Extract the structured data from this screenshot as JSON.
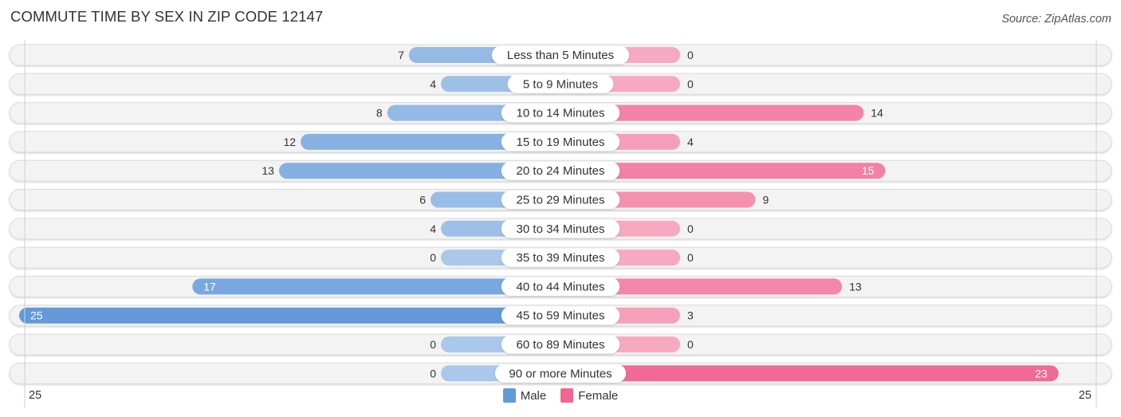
{
  "header": {
    "title": "COMMUTE TIME BY SEX IN ZIP CODE 12147",
    "source": "Source: ZipAtlas.com"
  },
  "colors": {
    "male_strong": "#6399d8",
    "male_light": "#a9c8ea",
    "female_strong": "#f06592",
    "female_light": "#f7a9c2",
    "row_bg": "#f3f3f3",
    "row_border": "#dcdcdc"
  },
  "legend": [
    {
      "label": "Male",
      "color": "#6399d8"
    },
    {
      "label": "Female",
      "color": "#f06592"
    }
  ],
  "axis": {
    "left_label": "25",
    "right_label": "25"
  },
  "chart_data": {
    "type": "bar",
    "orientation": "horizontal-diverging",
    "title": "COMMUTE TIME BY SEX IN ZIP CODE 12147",
    "source": "Source: ZipAtlas.com",
    "xlim": [
      -25,
      25
    ],
    "x_tick_labels": [
      "25",
      "25"
    ],
    "legend_position": "bottom-center",
    "categories": [
      "Less than 5 Minutes",
      "5 to 9 Minutes",
      "10 to 14 Minutes",
      "15 to 19 Minutes",
      "20 to 24 Minutes",
      "25 to 29 Minutes",
      "30 to 34 Minutes",
      "35 to 39 Minutes",
      "40 to 44 Minutes",
      "45 to 59 Minutes",
      "60 to 89 Minutes",
      "90 or more Minutes"
    ],
    "series": [
      {
        "name": "Male",
        "side": "left",
        "values": [
          7,
          4,
          8,
          12,
          13,
          6,
          4,
          0,
          17,
          25,
          0,
          0
        ]
      },
      {
        "name": "Female",
        "side": "right",
        "values": [
          0,
          0,
          14,
          4,
          15,
          9,
          0,
          0,
          13,
          3,
          0,
          23
        ]
      }
    ]
  }
}
